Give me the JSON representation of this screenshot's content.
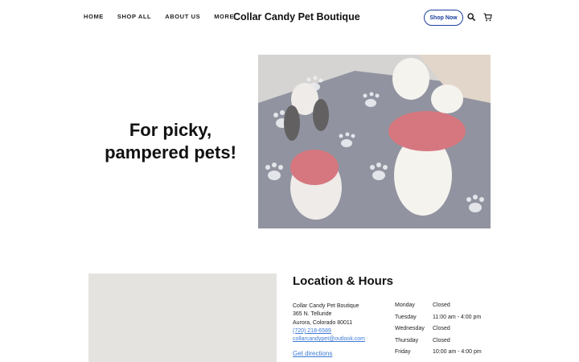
{
  "nav": {
    "items": [
      {
        "label": "HOME"
      },
      {
        "label": "SHOP ALL"
      },
      {
        "label": "ABOUT US"
      },
      {
        "label": "MORE"
      }
    ]
  },
  "brand": {
    "name": "Collar Candy Pet Boutique"
  },
  "header_actions": {
    "shop_now_label": "Shop Now",
    "search_icon": "search-icon",
    "cart_icon": "cart-icon",
    "accent_color": "#1d3f9e"
  },
  "hero": {
    "heading_line1": "For picky,",
    "heading_line2": "pampered pets!",
    "image_subject": "two small dogs wearing red jerseys on a paw-print rug"
  },
  "location": {
    "title": "Location & Hours",
    "business_name": "Collar Candy Pet Boutique",
    "street": "365 N. Telluride",
    "city_state_zip": "Aurora, Colorado 80011",
    "phone": "(720) 218-6589",
    "email": "collarcandypet@outlook.com",
    "directions_label": "Get directions",
    "link_color": "#3c7ad6",
    "hours": [
      {
        "day": "Monday",
        "time": "Closed"
      },
      {
        "day": "Tuesday",
        "time": "11:00 am - 4:00 pm"
      },
      {
        "day": "Wednesday",
        "time": "Closed"
      },
      {
        "day": "Thursday",
        "time": "Closed"
      },
      {
        "day": "Friday",
        "time": "10:00 am - 4:00 pm"
      }
    ]
  }
}
